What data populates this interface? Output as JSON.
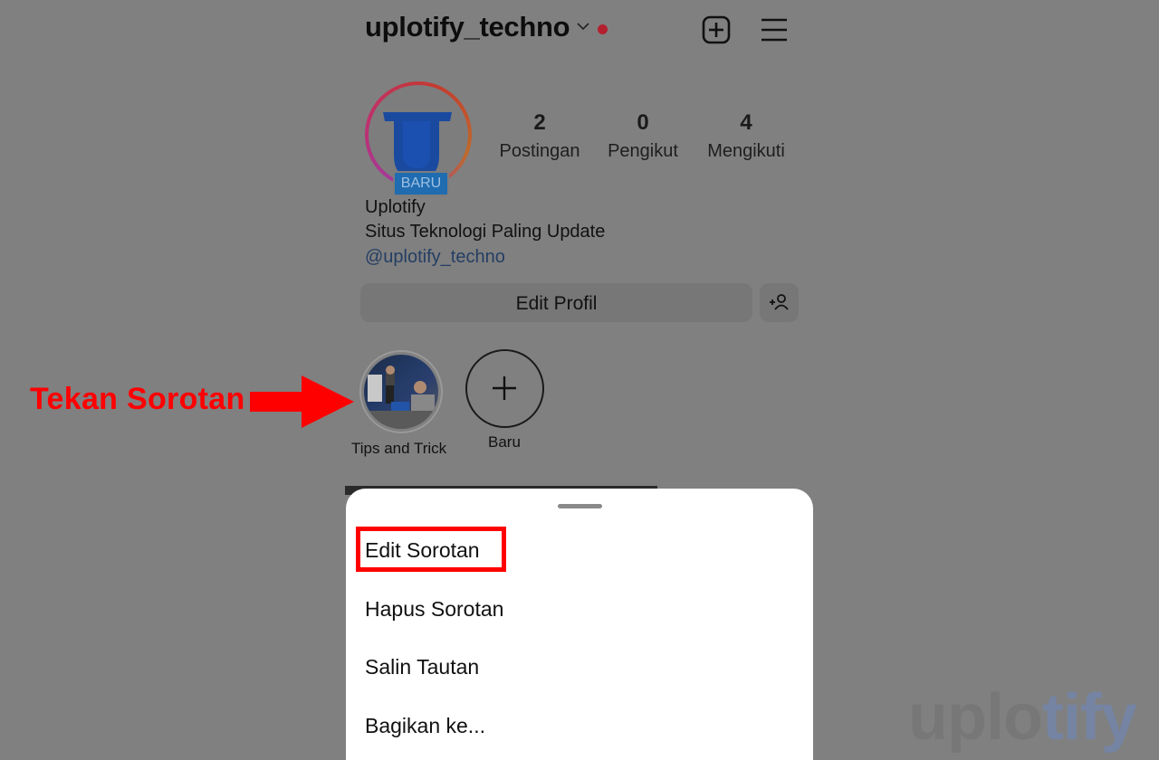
{
  "header": {
    "username": "uplotify_techno",
    "icons": [
      "chevron-down-icon",
      "notification-dot",
      "add-post-icon",
      "menu-icon"
    ],
    "colors": {
      "notification_dot": "#b3202e"
    }
  },
  "profile": {
    "avatar_badge": "BARU",
    "stats": [
      {
        "value": "2",
        "label": "Postingan"
      },
      {
        "value": "0",
        "label": "Pengikut"
      },
      {
        "value": "4",
        "label": "Mengikuti"
      }
    ],
    "name": "Uplotify",
    "bio": "Situs Teknologi Paling Update",
    "link": "@uplotify_techno",
    "edit_button": "Edit Profil"
  },
  "highlights": [
    {
      "label": "Tips and Trick"
    },
    {
      "label": "Baru"
    }
  ],
  "annotation": {
    "text": "Tekan Sorotan",
    "color": "#ff0000"
  },
  "sheet": {
    "items": [
      "Edit Sorotan",
      "Hapus Sorotan",
      "Salin Tautan",
      "Bagikan ke..."
    ],
    "highlighted_index": 0
  },
  "watermark": {
    "part1": "uplo",
    "part2": "tify"
  }
}
